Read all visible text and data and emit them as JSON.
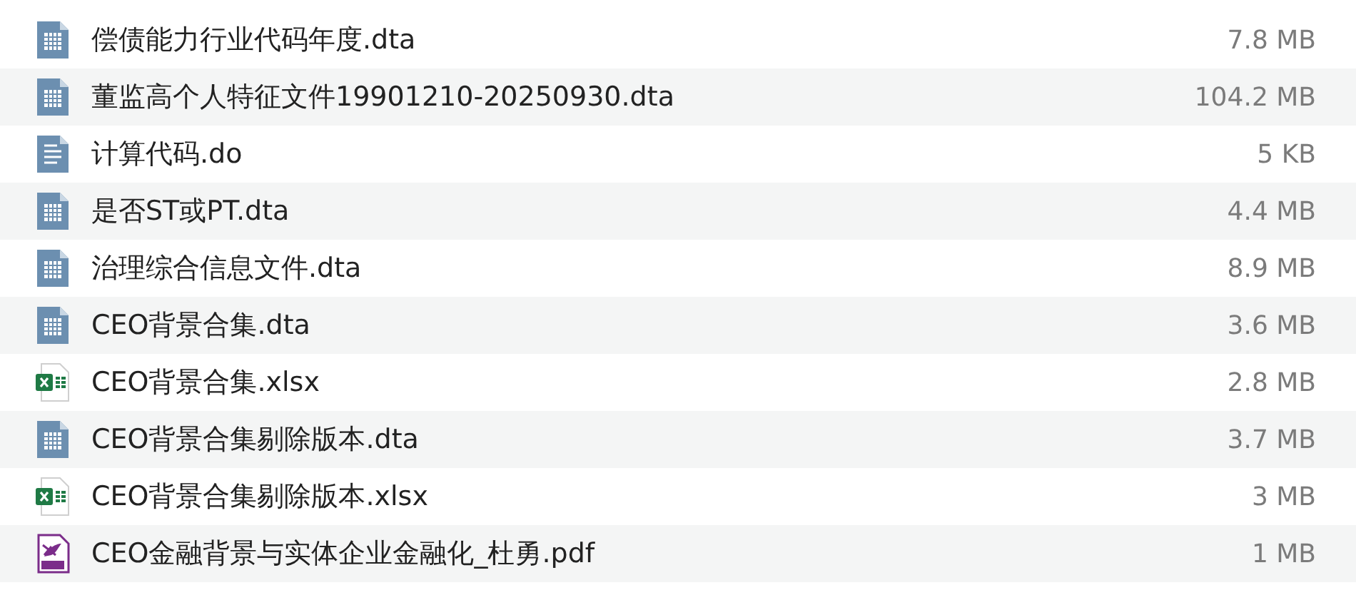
{
  "files": [
    {
      "name": "偿债能力行业代码年度.dta",
      "size": "7.8 MB",
      "kind": "dta"
    },
    {
      "name": "董监高个人特征文件19901210-20250930.dta",
      "size": "104.2 MB",
      "kind": "dta"
    },
    {
      "name": "计算代码.do",
      "size": "5 KB",
      "kind": "do"
    },
    {
      "name": "是否ST或PT.dta",
      "size": "4.4 MB",
      "kind": "dta"
    },
    {
      "name": "治理综合信息文件.dta",
      "size": "8.9 MB",
      "kind": "dta"
    },
    {
      "name": "CEO背景合集.dta",
      "size": "3.6 MB",
      "kind": "dta"
    },
    {
      "name": "CEO背景合集.xlsx",
      "size": "2.8 MB",
      "kind": "xlsx"
    },
    {
      "name": "CEO背景合集剔除版本.dta",
      "size": "3.7 MB",
      "kind": "dta"
    },
    {
      "name": "CEO背景合集剔除版本.xlsx",
      "size": "3 MB",
      "kind": "xlsx"
    },
    {
      "name": "CEO金融背景与实体企业金融化_杜勇.pdf",
      "size": "1 MB",
      "kind": "pdf"
    }
  ]
}
